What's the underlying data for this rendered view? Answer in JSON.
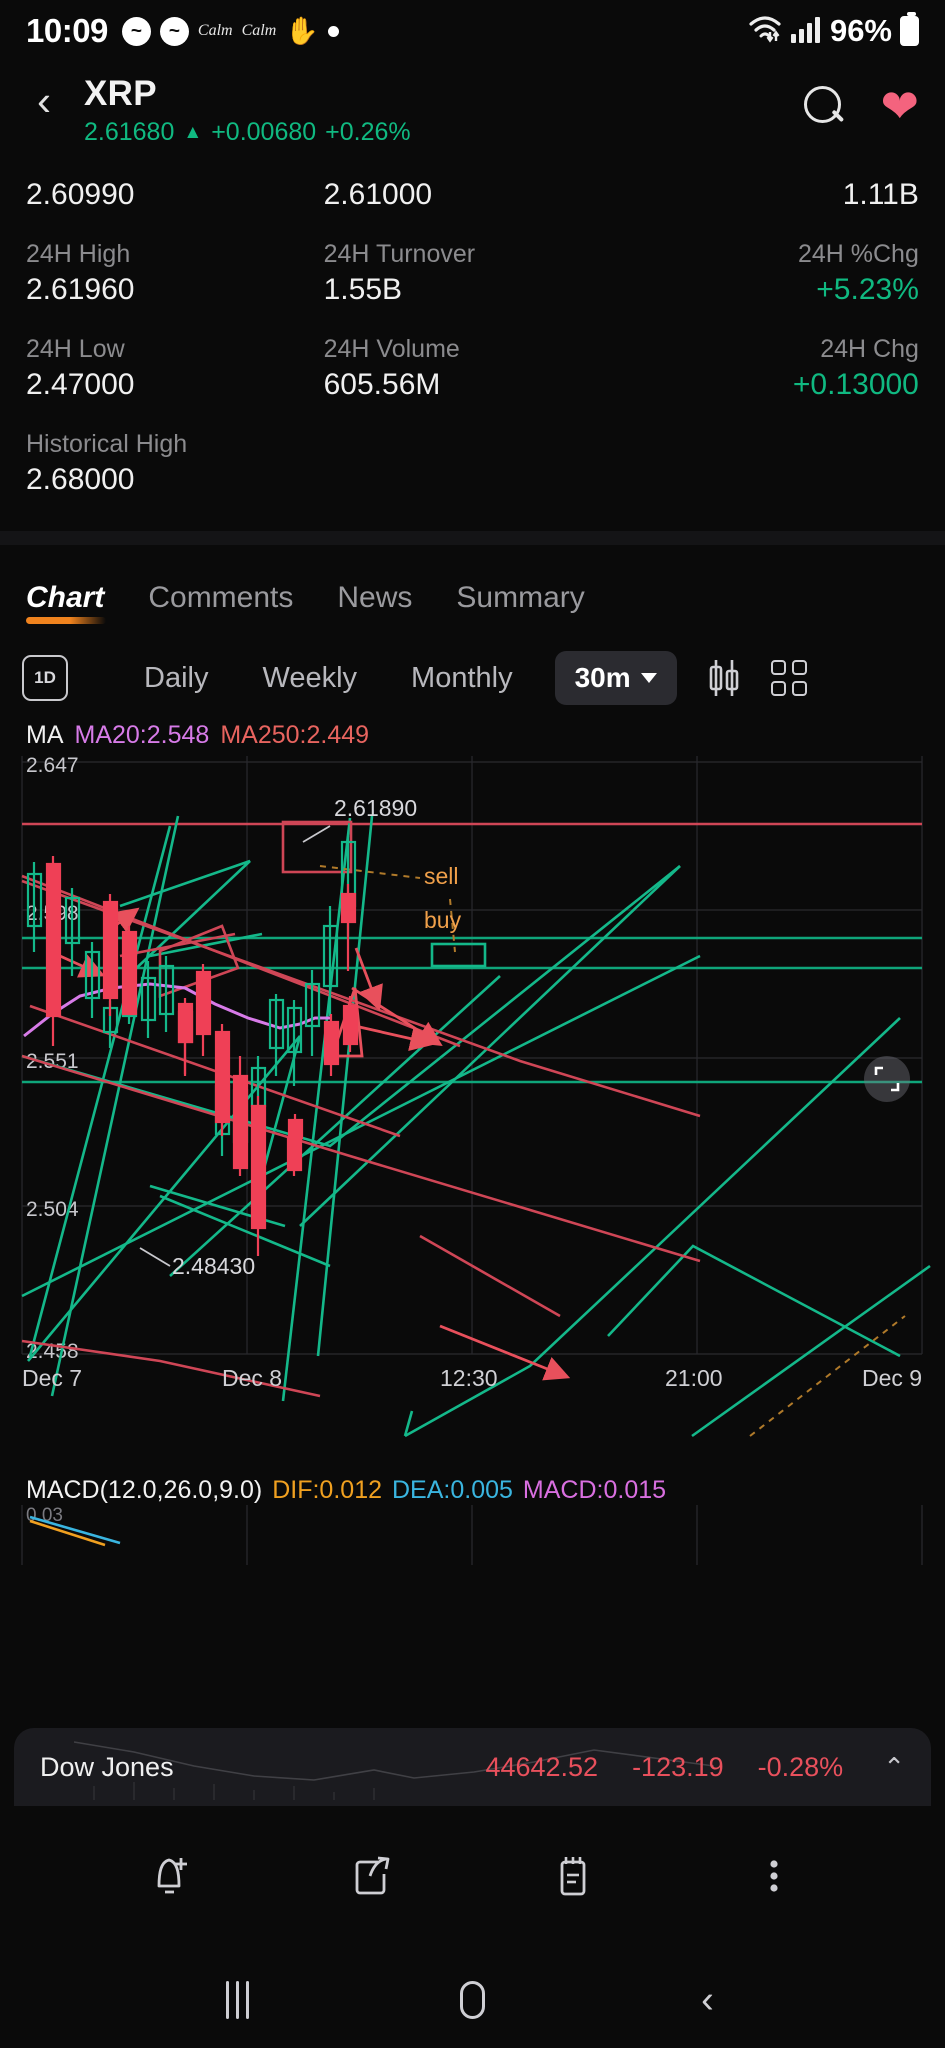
{
  "status_bar": {
    "time": "10:09",
    "messenger_glyph": "~",
    "app_labels": [
      "Calm",
      "Calm"
    ],
    "hand_icon": "✋",
    "battery_percent": "96%"
  },
  "header": {
    "back_icon": "‹",
    "symbol": "XRP",
    "price": "2.61680",
    "arrow": "▲",
    "change_abs": "+0.00680",
    "change_pct": "+0.26%",
    "accent_up": "#10b981",
    "favorite_color": "#f4637e"
  },
  "stats": {
    "row0": [
      {
        "label": "",
        "value": "2.60990"
      },
      {
        "label": "",
        "value": "2.61000"
      },
      {
        "label": "",
        "value": "1.11B"
      }
    ],
    "rows": [
      [
        {
          "label": "24H High",
          "value": "2.61960",
          "color": "normal"
        },
        {
          "label": "24H Turnover",
          "value": "1.55B",
          "color": "normal"
        },
        {
          "label": "24H %Chg",
          "value": "+5.23%",
          "color": "green"
        }
      ],
      [
        {
          "label": "24H Low",
          "value": "2.47000",
          "color": "normal"
        },
        {
          "label": "24H Volume",
          "value": "605.56M",
          "color": "normal"
        },
        {
          "label": "24H Chg",
          "value": "+0.13000",
          "color": "green"
        }
      ],
      [
        {
          "label": "Historical High",
          "value": "2.68000",
          "color": "normal"
        },
        {
          "label": "",
          "value": "",
          "color": "normal"
        },
        {
          "label": "",
          "value": "",
          "color": "normal"
        }
      ]
    ]
  },
  "tabs": [
    {
      "label": "Chart",
      "active": true
    },
    {
      "label": "Comments",
      "active": false
    },
    {
      "label": "News",
      "active": false
    },
    {
      "label": "Summary",
      "active": false
    }
  ],
  "timeframe_bar": {
    "one_day_label": "1D",
    "items": [
      "Daily",
      "Weekly",
      "Monthly"
    ],
    "selected": "30m",
    "caret": "▾"
  },
  "ma_legend": {
    "title": "MA",
    "ma20": "MA20:2.548",
    "ma250": "MA250:2.449",
    "ma20_color": "#d77be8",
    "ma250_color": "#e8645f"
  },
  "macd_legend": {
    "title": "MACD(12.0,26.0,9.0)",
    "dif": "DIF:0.012",
    "dea": "DEA:0.005",
    "macd": "MACD:0.015",
    "dif_color": "#f0a020",
    "dea_color": "#3ab5e0",
    "macd_color": "#d96fe0"
  },
  "chart_data": {
    "type": "candlestick",
    "title": "XRP 30m",
    "xlabel": "",
    "ylabel": "",
    "ylim": [
      2.458,
      2.647
    ],
    "y_ticks": [
      "2.647",
      "2.598",
      "2.551",
      "2.504",
      "2.458"
    ],
    "x_ticks": [
      "Dec 7",
      "Dec 8",
      "12:30",
      "21:00",
      "Dec 9"
    ],
    "grid": true,
    "legend_position": "top-left",
    "annotations": [
      {
        "text": "2.61890",
        "kind": "high-label",
        "color": "#d8d8dc"
      },
      {
        "text": "2.48430",
        "kind": "low-label",
        "color": "#d8d8dc"
      },
      {
        "text": "sell",
        "kind": "drawing-label",
        "color": "#f0a04a"
      },
      {
        "text": "buy",
        "kind": "drawing-label",
        "color": "#f0a04a"
      }
    ],
    "series": [
      {
        "name": "MA20",
        "color": "#d77be8",
        "last_value": 2.548
      },
      {
        "name": "MA250",
        "color": "#e8645f",
        "last_value": 2.449
      }
    ],
    "candles": [
      {
        "o": 2.5975,
        "h": 2.6,
        "l": 2.582,
        "c": 2.587,
        "dir": "up"
      },
      {
        "o": 2.599,
        "h": 2.601,
        "l": 2.554,
        "c": 2.556,
        "dir": "down"
      },
      {
        "o": 2.57,
        "h": 2.58,
        "l": 2.552,
        "c": 2.576,
        "dir": "up"
      },
      {
        "o": 2.579,
        "h": 2.581,
        "l": 2.535,
        "c": 2.546,
        "dir": "down"
      },
      {
        "o": 2.548,
        "h": 2.55,
        "l": 2.526,
        "c": 2.544,
        "dir": "down"
      },
      {
        "o": 2.543,
        "h": 2.55,
        "l": 2.538,
        "c": 2.547,
        "dir": "up"
      },
      {
        "o": 2.549,
        "h": 2.566,
        "l": 2.54,
        "c": 2.563,
        "dir": "up"
      },
      {
        "o": 2.564,
        "h": 2.568,
        "l": 2.543,
        "c": 2.546,
        "dir": "down"
      },
      {
        "o": 2.547,
        "h": 2.548,
        "l": 2.514,
        "c": 2.518,
        "dir": "down"
      },
      {
        "o": 2.518,
        "h": 2.52,
        "l": 2.4843,
        "c": 2.496,
        "dir": "down"
      },
      {
        "o": 2.496,
        "h": 2.523,
        "l": 2.494,
        "c": 2.519,
        "dir": "up"
      },
      {
        "o": 2.516,
        "h": 2.522,
        "l": 2.505,
        "c": 2.508,
        "dir": "down"
      },
      {
        "o": 2.509,
        "h": 2.545,
        "l": 2.506,
        "c": 2.54,
        "dir": "up"
      },
      {
        "o": 2.541,
        "h": 2.552,
        "l": 2.529,
        "c": 2.531,
        "dir": "down"
      },
      {
        "o": 2.532,
        "h": 2.56,
        "l": 2.53,
        "c": 2.556,
        "dir": "up"
      },
      {
        "o": 2.557,
        "h": 2.562,
        "l": 2.54,
        "c": 2.543,
        "dir": "down"
      },
      {
        "o": 2.544,
        "h": 2.564,
        "l": 2.541,
        "c": 2.56,
        "dir": "up"
      },
      {
        "o": 2.561,
        "h": 2.566,
        "l": 2.524,
        "c": 2.526,
        "dir": "down"
      },
      {
        "o": 2.526,
        "h": 2.528,
        "l": 2.518,
        "c": 2.522,
        "dir": "down"
      },
      {
        "o": 2.523,
        "h": 2.556,
        "l": 2.519,
        "c": 2.552,
        "dir": "up"
      },
      {
        "o": 2.553,
        "h": 2.562,
        "l": 2.548,
        "c": 2.559,
        "dir": "up"
      },
      {
        "o": 2.56,
        "h": 2.586,
        "l": 2.558,
        "c": 2.583,
        "dir": "up"
      },
      {
        "o": 2.584,
        "h": 2.592,
        "l": 2.574,
        "c": 2.589,
        "dir": "up"
      },
      {
        "o": 2.59,
        "h": 2.594,
        "l": 2.58,
        "c": 2.583,
        "dir": "down"
      },
      {
        "o": 2.584,
        "h": 2.6189,
        "l": 2.58,
        "c": 2.615,
        "dir": "up"
      }
    ]
  },
  "dow_bar": {
    "name": "Dow Jones",
    "value": "44642.52",
    "change": "-123.19",
    "change_pct": "-0.28%",
    "chevron": "⌃",
    "color": "#e8505c"
  },
  "action_bar": [
    {
      "name": "alert-add",
      "glyph": "bell-plus"
    },
    {
      "name": "share",
      "glyph": "share"
    },
    {
      "name": "notes",
      "glyph": "notepad"
    },
    {
      "name": "more",
      "glyph": "dots"
    }
  ],
  "nav_bar": {
    "recent_label": "|||",
    "home_label": "home",
    "back_label": "‹"
  }
}
